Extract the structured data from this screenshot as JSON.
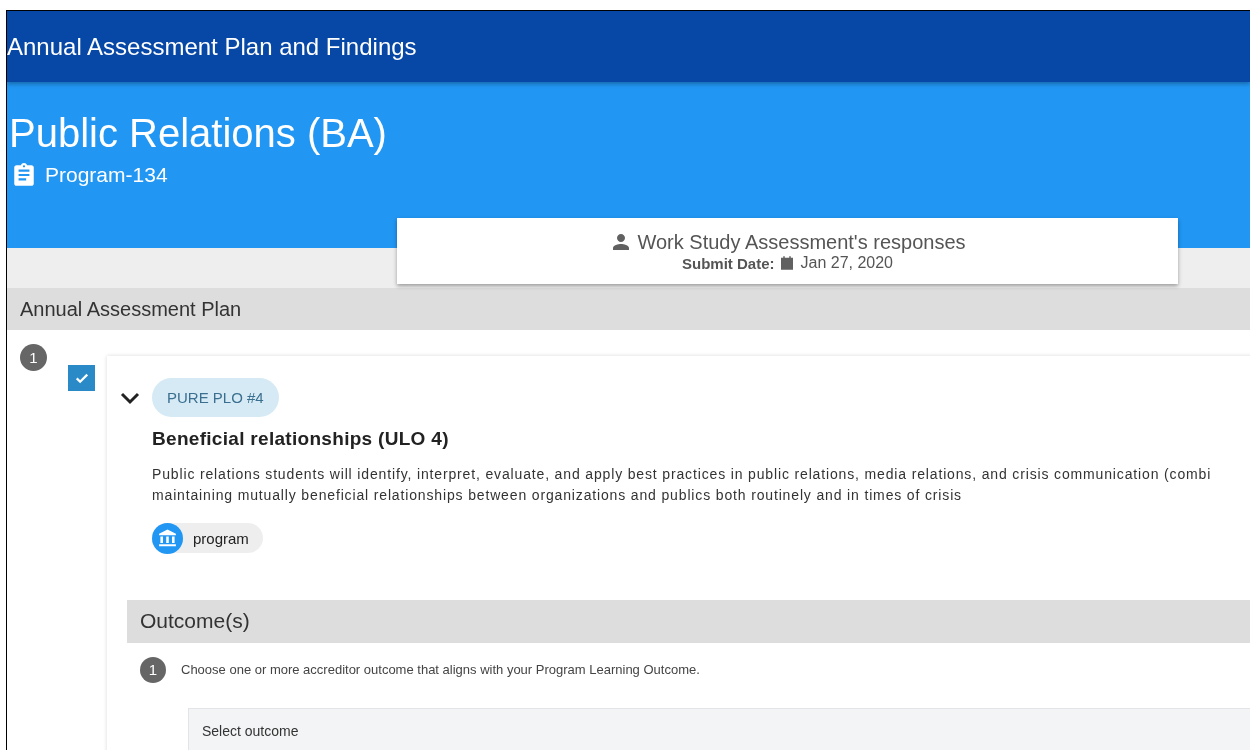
{
  "app_bar": {
    "title": "Annual Assessment Plan and Findings"
  },
  "program": {
    "title": "Public Relations (BA)",
    "code": "Program-134"
  },
  "responses_card": {
    "title": "Work Study Assessment's responses",
    "submit_label": "Submit Date:",
    "submit_date": "Jan 27, 2020"
  },
  "section": {
    "title": "Annual Assessment Plan"
  },
  "items": [
    {
      "number": "1",
      "checked": true,
      "expanded": true,
      "chip": "PURE PLO #4",
      "title": "Beneficial relationships (ULO 4)",
      "description_lines": [
        "Public relations students will identify, interpret, evaluate, and apply best practices in public relations, media relations, and crisis communication (combi",
        "maintaining mutually beneficial relationships between organizations and publics both routinely and in times of crisis"
      ],
      "tag": "program",
      "outcomes": {
        "title": "Outcome(s)",
        "steps": [
          {
            "number": "1",
            "text": "Choose one or more accreditor outcome that aligns with your Program Learning Outcome.",
            "placeholder": "Select outcome"
          }
        ]
      }
    }
  ]
}
